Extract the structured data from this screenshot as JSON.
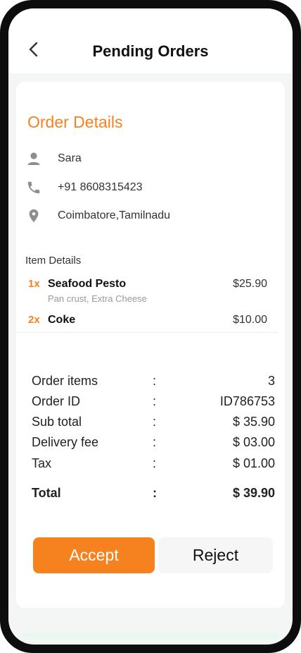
{
  "header": {
    "title": "Pending Orders"
  },
  "order_details": {
    "title": "Order Details",
    "customer_name": "Sara",
    "phone": "+91 8608315423",
    "location": "Coimbatore,Tamilnadu"
  },
  "items": {
    "heading": "Item Details",
    "list": [
      {
        "qty": "1x",
        "name": "Seafood Pesto",
        "extras": "Pan crust, Extra Cheese",
        "price": "$25.90"
      },
      {
        "qty": "2x",
        "name": "Coke",
        "extras": "",
        "price": "$10.00"
      }
    ]
  },
  "summary": {
    "rows": [
      {
        "label": "Order items",
        "sep": ":",
        "value": "3"
      },
      {
        "label": "Order ID",
        "sep": ":",
        "value": "ID786753"
      },
      {
        "label": "Sub total",
        "sep": ":",
        "value": "$ 35.90"
      },
      {
        "label": "Delivery fee",
        "sep": ":",
        "value": "$ 03.00"
      },
      {
        "label": "Tax",
        "sep": ":",
        "value": "$ 01.00"
      }
    ],
    "total": {
      "label": "Total",
      "sep": ":",
      "value": "$ 39.90"
    }
  },
  "actions": {
    "accept_label": "Accept",
    "reject_label": "Reject"
  },
  "colors": {
    "accent": "#f5821f",
    "icon_gray": "#8e8e8e"
  },
  "icons": {
    "back": "chevron-left-icon",
    "user": "person-icon",
    "phone": "phone-icon",
    "location": "location-pin-icon"
  }
}
